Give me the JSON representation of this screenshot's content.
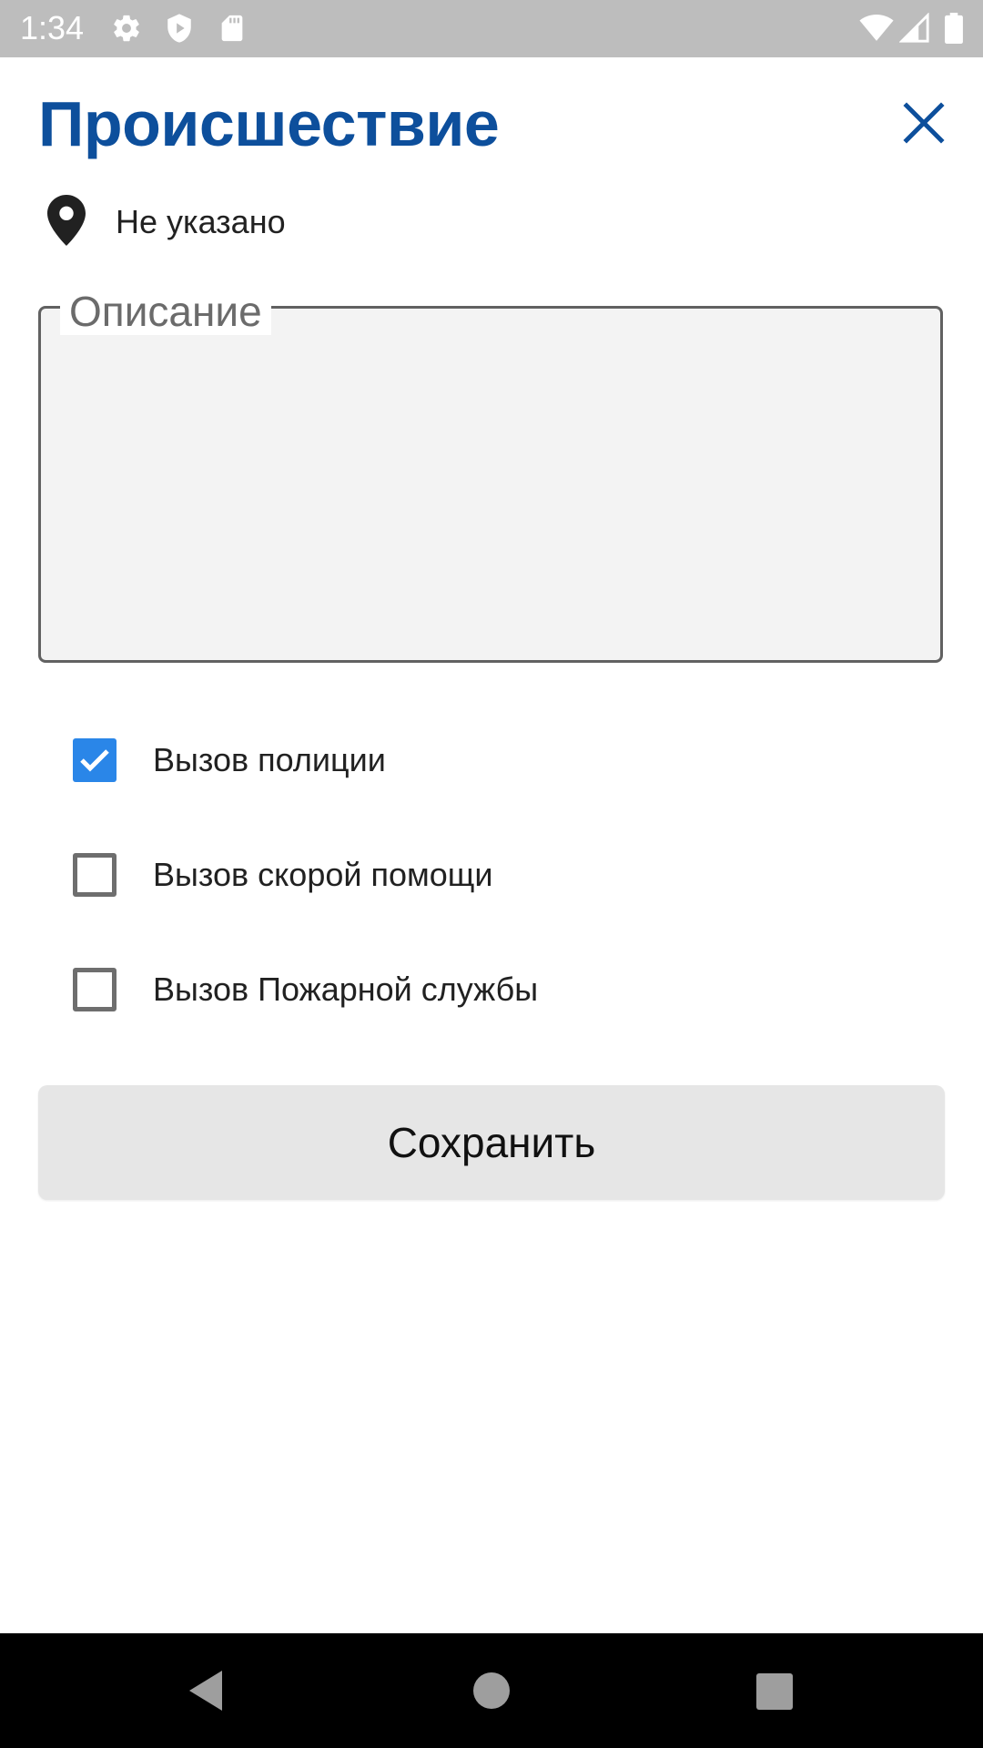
{
  "status_bar": {
    "time": "1:34",
    "icons": [
      "gear-icon",
      "shield-icon",
      "sd-card-icon",
      "wifi-icon",
      "signal-icon",
      "battery-icon"
    ]
  },
  "header": {
    "title": "Происшествие",
    "close_icon": "close-icon"
  },
  "location": {
    "icon": "location-pin-icon",
    "text": "Не указано"
  },
  "description": {
    "label": "Описание",
    "value": ""
  },
  "options": [
    {
      "label": "Вызов полиции",
      "checked": true
    },
    {
      "label": "Вызов скорой помощи",
      "checked": false
    },
    {
      "label": "Вызов Пожарной службы",
      "checked": false
    }
  ],
  "actions": {
    "save_label": "Сохранить"
  },
  "navigation": {
    "icons": [
      "back-icon",
      "home-icon",
      "recents-icon"
    ]
  },
  "colors": {
    "title": "#0d4f9c",
    "checkbox_checked": "#2a86e8",
    "status_bar": "#bdbdbd",
    "button_bg": "#e6e6e6"
  }
}
